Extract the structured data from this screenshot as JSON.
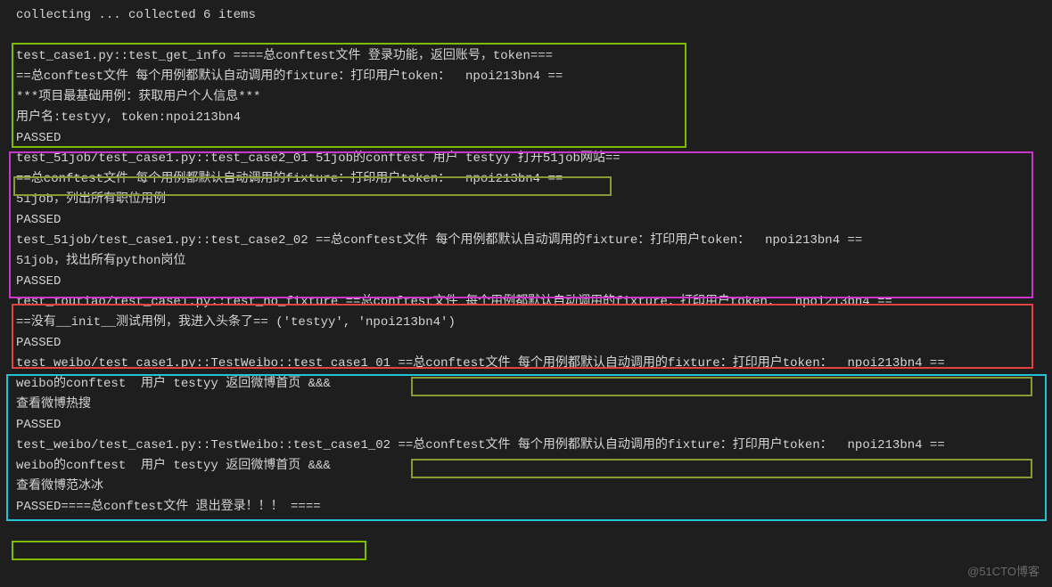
{
  "header": {
    "collecting": "collecting ... collected 6 items"
  },
  "block1": {
    "l1": "test_case1.py::test_get_info ====总conftest文件 登录功能，返回账号，token===",
    "l2": "==总conftest文件 每个用例都默认自动调用的fixture：打印用户token：  npoi213bn4 ==",
    "l3": "***项目最基础用例：获取用户个人信息***",
    "l4": "用户名:testyy, token:npoi213bn4",
    "l5": "PASSED"
  },
  "block2": {
    "l1": "test_51job/test_case1.py::test_case2_01 51job的conftest 用户 testyy 打开51job网站==",
    "l2": "==总conftest文件 每个用例都默认自动调用的fixture：打印用户token：  npoi213bn4 ==",
    "l3": "51job，列出所有职位用例",
    "l4": "PASSED",
    "l5": "test_51job/test_case1.py::test_case2_02 ==总conftest文件 每个用例都默认自动调用的fixture：打印用户token：  npoi213bn4 ==",
    "l6": "51job，找出所有python岗位",
    "l7": "PASSED"
  },
  "block3": {
    "l1": "test_toutiao/test_case1.py::test_no_fixture ==总conftest文件 每个用例都默认自动调用的fixture：打印用户token：  npoi213bn4 ==",
    "l2": "==没有__init__测试用例，我进入头条了== ('testyy', 'npoi213bn4')",
    "l3": "PASSED"
  },
  "block4": {
    "l1a": "test_weibo/test_case1.py::TestWeibo::test_case1_01 ",
    "l1b": "==总conftest文件 每个用例都默认自动调用的fixture：打印用户token：  npoi213bn4 ==",
    "l2": "weibo的conftest  用户 testyy 返回微博首页 &&&",
    "l3": "查看微博热搜",
    "l4": "PASSED",
    "l5a": "test_weibo/test_case1.py::TestWeibo::test_case1_02 ",
    "l5b": "==总conftest文件 每个用例都默认自动调用的fixture：打印用户token：  npoi213bn4 ==",
    "l6": "weibo的conftest  用户 testyy 返回微博首页 &&&",
    "l7": "查看微博范冰冰"
  },
  "footer": {
    "l1": "PASSED====总conftest文件 退出登录！！！ ====",
    "watermark": "@51CTO博客"
  }
}
